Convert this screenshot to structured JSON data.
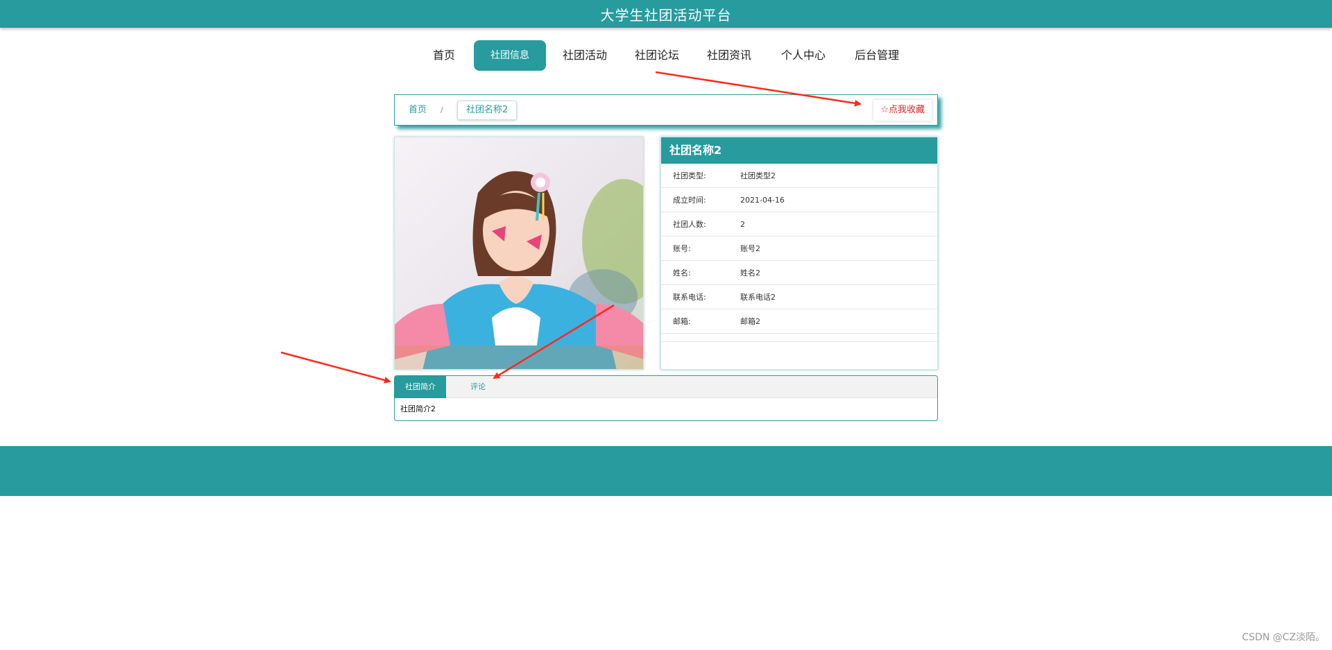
{
  "header": {
    "title": "大学生社团活动平台"
  },
  "nav": {
    "items": [
      {
        "label": "首页"
      },
      {
        "label": "社团信息"
      },
      {
        "label": "社团活动"
      },
      {
        "label": "社团论坛"
      },
      {
        "label": "社团资讯"
      },
      {
        "label": "个人中心"
      },
      {
        "label": "后台管理"
      }
    ],
    "active": "社团信息"
  },
  "breadcrumb": {
    "home": "首页",
    "separator": "/",
    "current": "社团名称2"
  },
  "favorite": {
    "icon": "star-outline-icon",
    "label": "☆点我收藏"
  },
  "club": {
    "name": "社团名称2",
    "fields": [
      {
        "label": "社团类型:",
        "value": "社团类型2"
      },
      {
        "label": "成立时间:",
        "value": "2021-04-16"
      },
      {
        "label": "社团人数:",
        "value": "2"
      },
      {
        "label": "账号:",
        "value": "账号2"
      },
      {
        "label": "姓名:",
        "value": "姓名2"
      },
      {
        "label": "联系电话:",
        "value": "联系电话2"
      },
      {
        "label": "邮箱:",
        "value": "邮箱2"
      }
    ]
  },
  "tabs": {
    "items": [
      {
        "label": "社团简介"
      },
      {
        "label": "评论"
      }
    ],
    "active": "社团简介",
    "content": "社团简介2"
  },
  "watermark": "CSDN @CZ淡陌。",
  "colors": {
    "primary": "#279b9e",
    "favorite": "#e02020",
    "annotation": "#ff2a1a"
  }
}
